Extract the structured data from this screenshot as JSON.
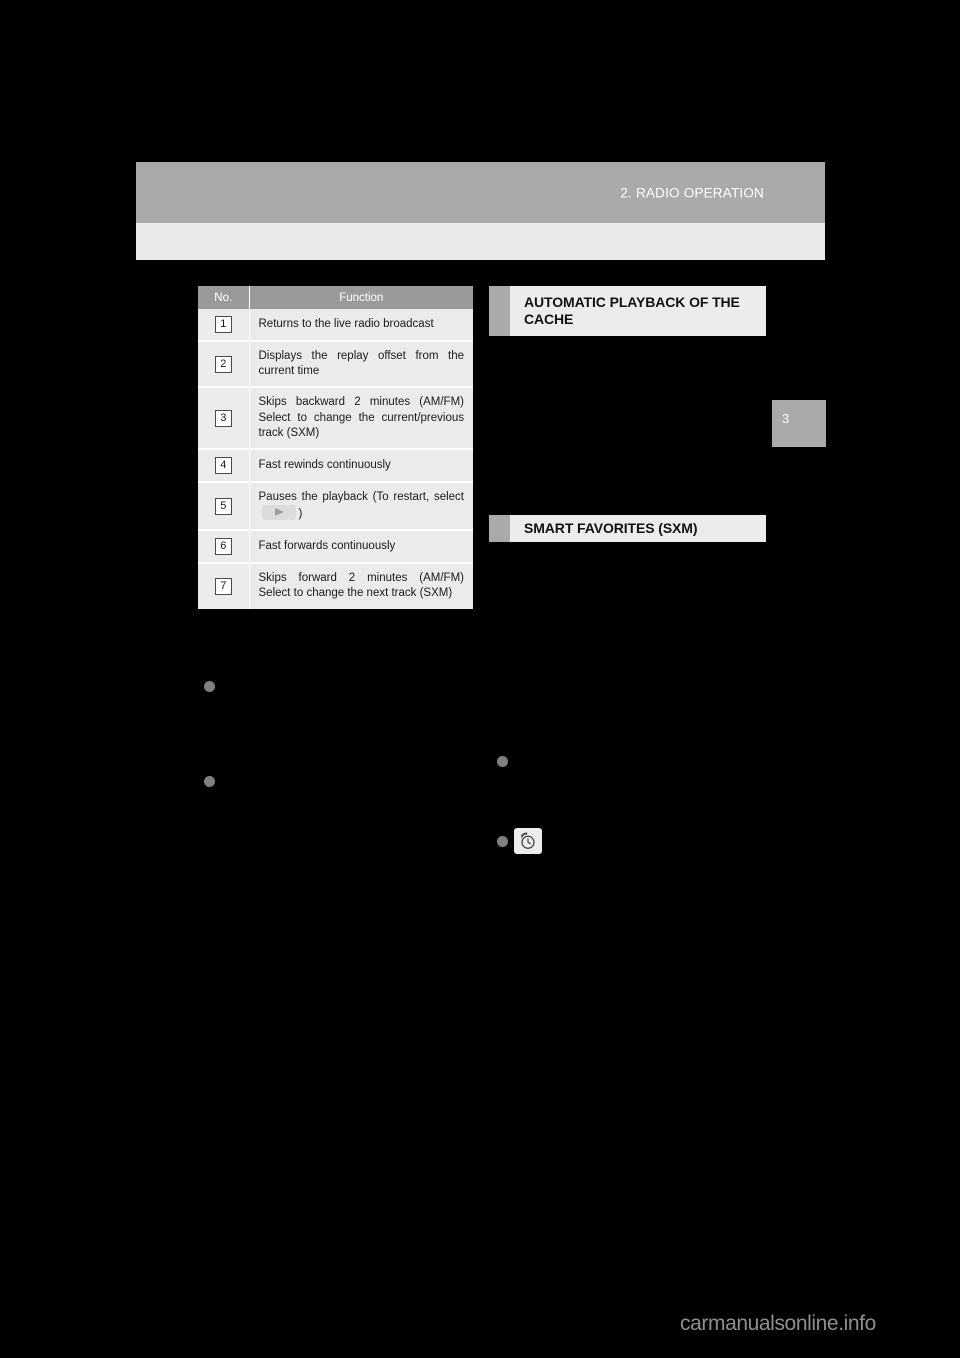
{
  "page": {
    "header_title": "2. RADIO OPERATION",
    "page_number": "3",
    "watermark": "carmanualsonline.info",
    "colors": {
      "page_background": "#000000",
      "header_band": "#aaaaaa",
      "header_subband": "#eaeaea",
      "table_header": "#9a9a9a",
      "table_row": "#ebebeb",
      "heading_bar": "#ececec",
      "heading_tab": "#aaaaaa",
      "bullet": "#808080"
    }
  },
  "table": {
    "columns": [
      "No.",
      "Function"
    ],
    "rows": [
      {
        "no": "1",
        "function": "Returns to the live radio broadcast"
      },
      {
        "no": "2",
        "function": "Displays the replay offset from the current time"
      },
      {
        "no": "3",
        "function": "Skips backward 2 minutes (AM/FM) Select to change the current/previous track (SXM)"
      },
      {
        "no": "4",
        "function": "Fast rewinds continuously"
      },
      {
        "no": "5",
        "function_before_key": "Pauses the playback (To restart, select",
        "key_icon": "play-icon",
        "function_after_key": ")"
      },
      {
        "no": "6",
        "function": "Fast forwards continuously"
      },
      {
        "no": "7",
        "function": "Skips forward 2 minutes (AM/FM) Select to change the next track (SXM)"
      }
    ]
  },
  "left_column": {
    "bullets": [
      {
        "text": ""
      },
      {
        "text": ""
      }
    ]
  },
  "right_column": {
    "headings": [
      {
        "text": "AUTOMATIC PLAYBACK OF THE CACHE"
      },
      {
        "text": "SMART FAVORITES (SXM)"
      }
    ],
    "bullets": [
      {
        "text": "",
        "icon": null
      },
      {
        "text": "",
        "icon": "alarm-clock-icon"
      }
    ]
  }
}
